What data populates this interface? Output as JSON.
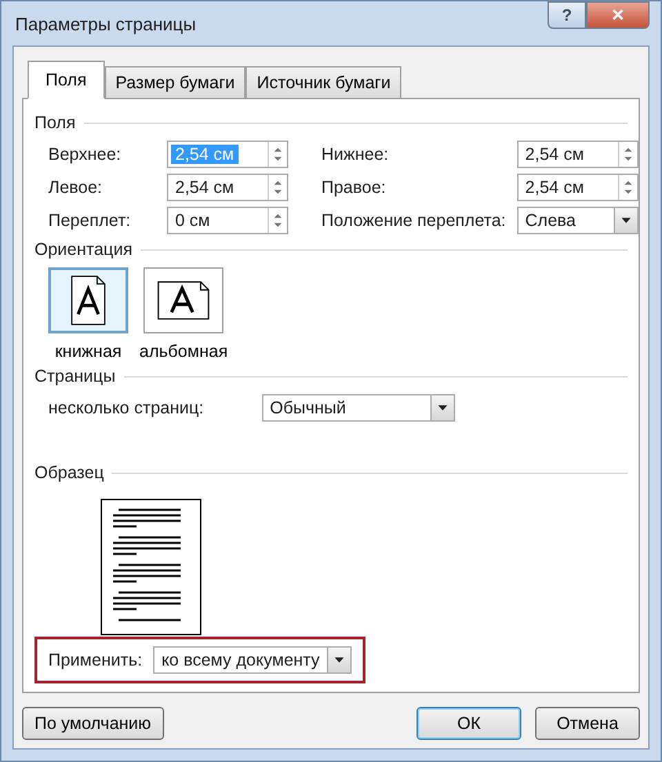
{
  "window": {
    "title": "Параметры страницы",
    "controls": [
      {
        "kind": "help",
        "label": "?"
      },
      {
        "kind": "close",
        "label": "✕"
      }
    ]
  },
  "tabs": [
    {
      "label": "Поля",
      "selected": true
    },
    {
      "label": "Размер бумаги",
      "selected": false
    },
    {
      "label": "Источник бумаги",
      "selected": false
    }
  ],
  "margins": {
    "title": "Поля",
    "fields": [
      {
        "label": "Верхнее:",
        "value": "2,54 см",
        "kind": "spin",
        "selected": true
      },
      {
        "label": "Нижнее:",
        "value": "2,54 см",
        "kind": "spin",
        "selected": false
      },
      {
        "label": "Левое:",
        "value": "2,54 см",
        "kind": "spin",
        "selected": false
      },
      {
        "label": "Правое:",
        "value": "2,54 см",
        "kind": "spin",
        "selected": false
      },
      {
        "label": "Переплет:",
        "value": "0 см",
        "kind": "spin",
        "selected": false
      },
      {
        "label": "Положение переплета:",
        "value": "Слева",
        "kind": "dropdown",
        "selected": false
      }
    ]
  },
  "orientation": {
    "title": "Ориентация",
    "options": [
      {
        "label": "книжная",
        "selected": true
      },
      {
        "label": "альбомная",
        "selected": false
      }
    ]
  },
  "pages": {
    "title": "Страницы",
    "label": "несколько страниц:",
    "value": "Обычный"
  },
  "preview": {
    "title": "Образец"
  },
  "apply": {
    "label": "Применить:",
    "value": "ко всему документу",
    "highlighted": true
  },
  "buttons": [
    {
      "label": "По умолчанию",
      "default": false
    },
    {
      "label": "ОК",
      "default": true
    },
    {
      "label": "Отмена",
      "default": false
    }
  ]
}
